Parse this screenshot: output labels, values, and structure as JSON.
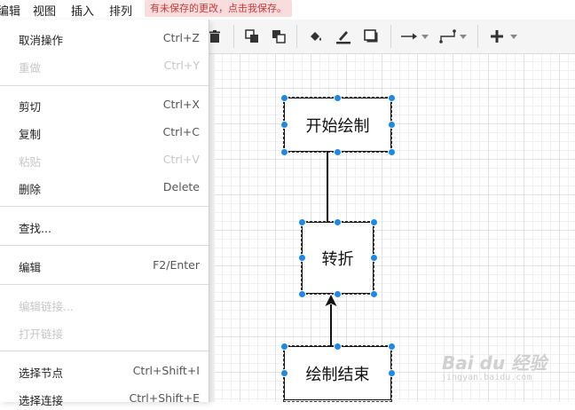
{
  "menubar": {
    "items": [
      "编辑",
      "视图",
      "插入",
      "排列"
    ],
    "unsaved_notice": "有未保存的更改，点击我保存。",
    "unsaved_color": "#c23b3b"
  },
  "toolbar": {
    "icons": [
      "delete-icon",
      "to-front-icon",
      "to-back-icon",
      "fill-color-icon",
      "line-color-icon",
      "shadow-icon",
      "connection-style-icon",
      "waypoints-icon",
      "insert-plus-icon"
    ]
  },
  "edit_menu": {
    "items": [
      {
        "label": "取消操作",
        "shortcut": "Ctrl+Z",
        "enabled": true
      },
      {
        "label": "重做",
        "shortcut": "Ctrl+Y",
        "enabled": false
      },
      {
        "label": "剪切",
        "shortcut": "Ctrl+X",
        "enabled": true
      },
      {
        "label": "复制",
        "shortcut": "Ctrl+C",
        "enabled": true
      },
      {
        "label": "粘贴",
        "shortcut": "Ctrl+V",
        "enabled": false
      },
      {
        "label": "删除",
        "shortcut": "Delete",
        "enabled": true
      },
      {
        "label": "查找...",
        "shortcut": "",
        "enabled": true
      },
      {
        "label": "编辑",
        "shortcut": "F2/Enter",
        "enabled": true
      },
      {
        "label": "编辑链接...",
        "shortcut": "",
        "enabled": false
      },
      {
        "label": "打开链接",
        "shortcut": "",
        "enabled": false
      },
      {
        "label": "选择节点",
        "shortcut": "Ctrl+Shift+I",
        "enabled": true
      },
      {
        "label": "选择连接",
        "shortcut": "Ctrl+Shift+E",
        "enabled": true
      }
    ]
  },
  "diagram": {
    "nodes": [
      "开始绘制",
      "转折",
      "绘制结束"
    ],
    "selection_color": "#1e88e5"
  },
  "watermark": {
    "brand": "Bai du 经验",
    "site": "jingyan.baidu.com"
  }
}
